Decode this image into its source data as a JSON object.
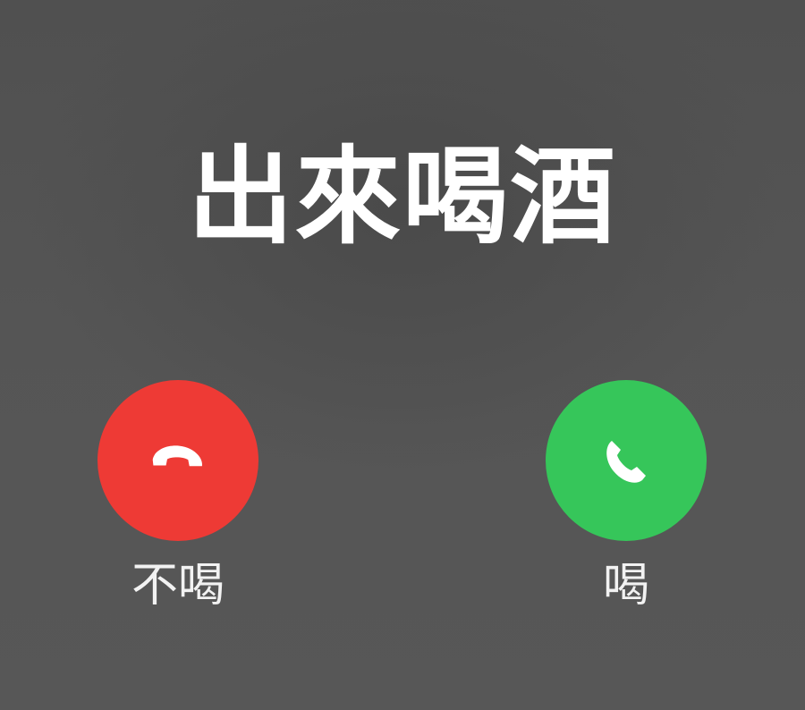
{
  "incoming_call": {
    "caller_name": "出來喝酒"
  },
  "actions": {
    "decline": {
      "label": "不喝",
      "icon": "hang-up-phone-icon",
      "color": "#ee3a35"
    },
    "accept": {
      "label": "喝",
      "icon": "phone-icon",
      "color": "#36c65a"
    }
  },
  "colors": {
    "background": "#545454",
    "text": "#ffffff"
  }
}
